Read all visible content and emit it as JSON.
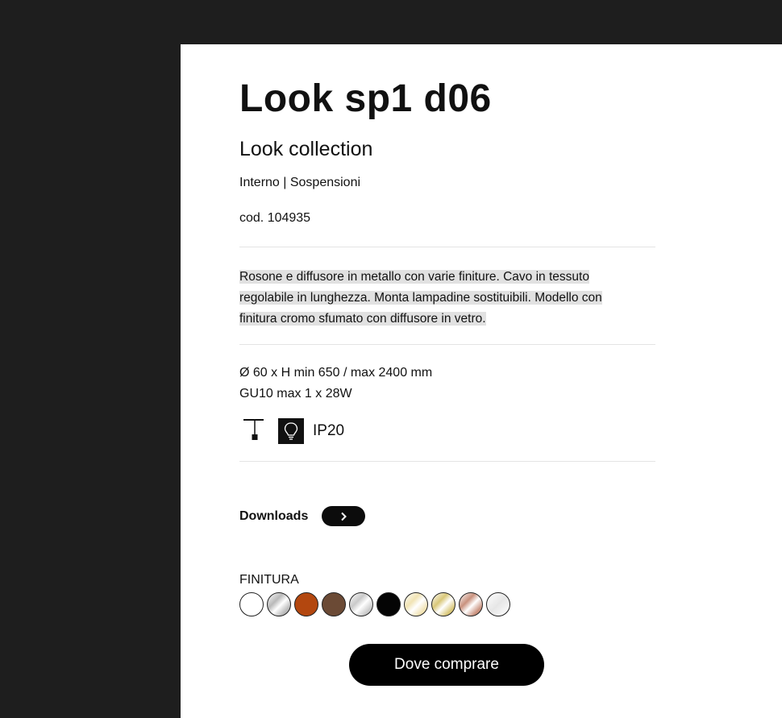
{
  "product": {
    "title": "Look sp1 d06",
    "collection": "Look collection",
    "category": "Interno | Sospensioni",
    "code": "cod. 104935",
    "description_lines": [
      "Rosone e diffusore in metallo con varie finiture. Cavo in tessuto",
      "regolabile in lunghezza. Monta lampadine sostituibili. Modello con",
      "finitura cromo sfumato con diffusore in vetro."
    ],
    "dimensions": "Ø 60 x H min 650 / max 2400 mm",
    "lamp": "GU10 max 1 x 28W",
    "ip_rating": "IP20"
  },
  "icons": {
    "mount": "pendant-mount-icon",
    "bulb": "replaceable-bulb-icon",
    "arrow": "chevron-right-icon"
  },
  "downloads": {
    "label": "Downloads"
  },
  "finish": {
    "label": "FINITURA",
    "swatches": [
      {
        "name": "white",
        "color": "#ffffff"
      },
      {
        "name": "chrome",
        "color": "#b9b9b9"
      },
      {
        "name": "copper-orange",
        "color": "#b3470f"
      },
      {
        "name": "bronze",
        "color": "#6b4a35"
      },
      {
        "name": "silver",
        "color": "#c9c9c9"
      },
      {
        "name": "black",
        "color": "#050505"
      },
      {
        "name": "champagne",
        "color": "#f1e3b4"
      },
      {
        "name": "gold",
        "color": "#d9c778"
      },
      {
        "name": "rose-gold",
        "color": "#c9917d"
      },
      {
        "name": "clear",
        "color": "#f7f7f7"
      }
    ]
  },
  "cta": {
    "label": "Dove comprare"
  }
}
